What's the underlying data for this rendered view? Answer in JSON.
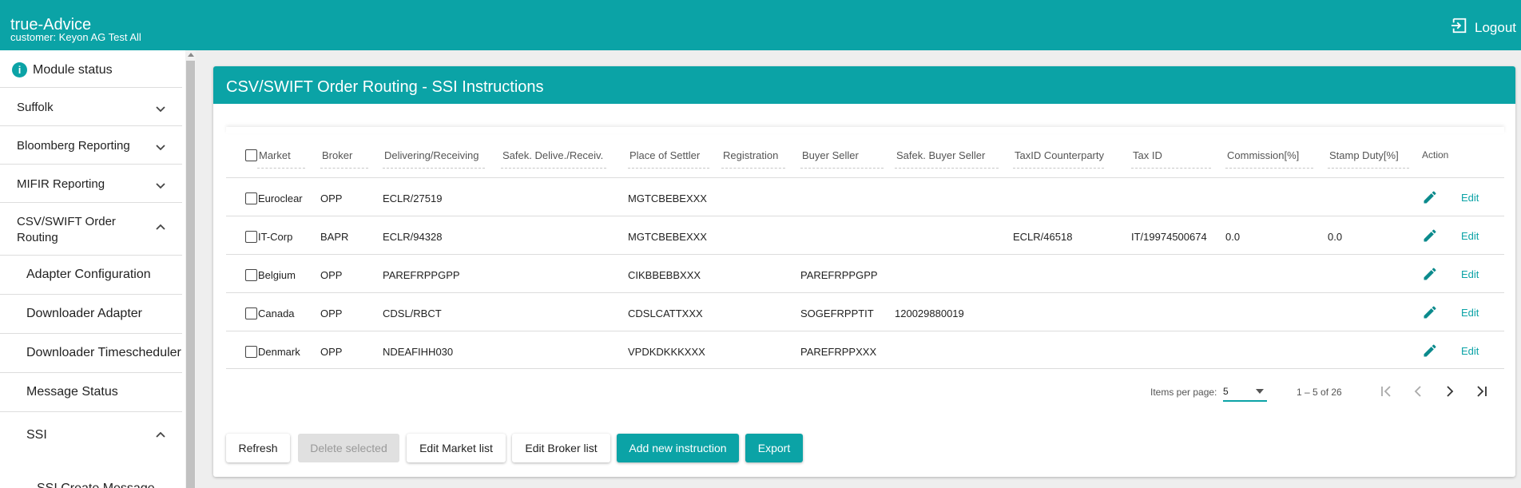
{
  "header": {
    "app_title": "true-Advice",
    "customer": "customer: Keyon AG Test All",
    "logout_label": "Logout",
    "logout_icon": "logout-icon"
  },
  "sidebar": {
    "module_status": "Module status",
    "items": [
      {
        "label": "Suffolk",
        "icon": "chevron-down-icon"
      },
      {
        "label": "Bloomberg Reporting",
        "icon": "chevron-down-icon"
      },
      {
        "label": "MIFIR Reporting",
        "icon": "chevron-down-icon"
      },
      {
        "label": "CSV/SWIFT Order Routing",
        "icon": "chevron-up-icon"
      }
    ],
    "sub_items": [
      {
        "label": "Adapter Configuration"
      },
      {
        "label": "Downloader Adapter"
      },
      {
        "label": "Downloader Timescheduler"
      },
      {
        "label": "Message Status"
      },
      {
        "label": "SSI",
        "icon": "chevron-up-icon"
      },
      {
        "label": "SSI Create Message"
      }
    ]
  },
  "card": {
    "title": "CSV/SWIFT Order Routing - SSI Instructions"
  },
  "table": {
    "columns": [
      "Market",
      "Broker",
      "Delivering/Receiving",
      "Safek. Delive./Receiv.",
      "Place of Settler",
      "Registration",
      "Buyer Seller",
      "Safek. Buyer Seller",
      "TaxID Counterparty",
      "Tax ID",
      "Commission[%]",
      "Stamp Duty[%]",
      "Action"
    ],
    "rows": [
      {
        "market": "Euroclear",
        "broker": "OPP",
        "delivering": "ECLR/27519",
        "safek_deliv": "",
        "place": "MGTCBEBEXXX",
        "registration": "",
        "buyer_seller": "",
        "safek_buyer": "",
        "taxid_cp": "",
        "tax_id": "",
        "commission": "",
        "stamp": "",
        "edit": "Edit"
      },
      {
        "market": "IT-Corp",
        "broker": "BAPR",
        "delivering": "ECLR/94328",
        "safek_deliv": "",
        "place": "MGTCBEBEXXX",
        "registration": "",
        "buyer_seller": "",
        "safek_buyer": "",
        "taxid_cp": "ECLR/46518",
        "tax_id": "IT/19974500674",
        "commission": "0.0",
        "stamp": "0.0",
        "edit": "Edit"
      },
      {
        "market": "Belgium",
        "broker": "OPP",
        "delivering": "PAREFRPPGPP",
        "safek_deliv": "",
        "place": "CIKBBEBBXXX",
        "registration": "",
        "buyer_seller": "PAREFRPPGPP",
        "safek_buyer": "",
        "taxid_cp": "",
        "tax_id": "",
        "commission": "",
        "stamp": "",
        "edit": "Edit"
      },
      {
        "market": "Canada",
        "broker": "OPP",
        "delivering": "CDSL/RBCT",
        "safek_deliv": "",
        "place": "CDSLCATTXXX",
        "registration": "",
        "buyer_seller": "SOGEFRPPTIT",
        "safek_buyer": "120029880019",
        "taxid_cp": "",
        "tax_id": "",
        "commission": "",
        "stamp": "",
        "edit": "Edit"
      },
      {
        "market": "Denmark",
        "broker": "OPP",
        "delivering": "NDEAFIHH030",
        "safek_deliv": "",
        "place": "VPDKDKKKXXX",
        "registration": "",
        "buyer_seller": "PAREFRPPXXX",
        "safek_buyer": "",
        "taxid_cp": "",
        "tax_id": "",
        "commission": "",
        "stamp": "",
        "edit": "Edit"
      }
    ]
  },
  "paginator": {
    "items_per_page_label": "Items per page:",
    "items_per_page_value": "5",
    "range": "1 – 5 of 26"
  },
  "buttons": {
    "refresh": "Refresh",
    "delete_selected": "Delete selected",
    "edit_market_list": "Edit Market list",
    "edit_broker_list": "Edit Broker list",
    "add_new_instruction": "Add new instruction",
    "export": "Export"
  },
  "colors": {
    "accent": "#0ba3a6",
    "icon_teal": "#0a8a8c"
  }
}
